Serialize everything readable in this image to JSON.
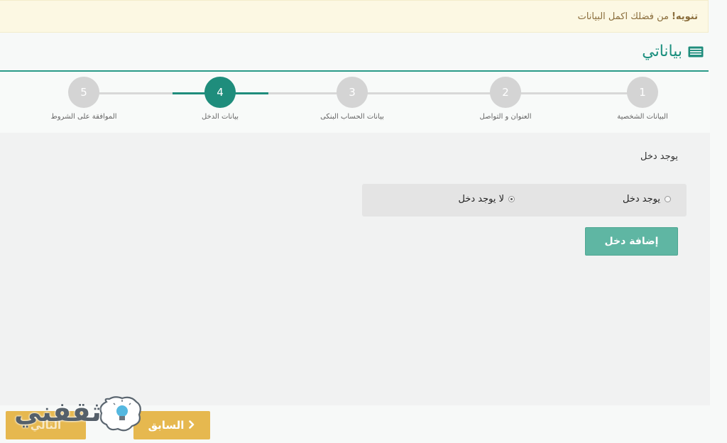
{
  "alert": {
    "strong": "تنويه!",
    "message": "من فضلك اكمل البيانات"
  },
  "section": {
    "title": "بياناتي",
    "icon": "card-icon"
  },
  "steps": [
    {
      "number": "1",
      "label": "البيانات الشخصية",
      "active": false
    },
    {
      "number": "2",
      "label": "العنوان و التواصل",
      "active": false
    },
    {
      "number": "3",
      "label": "بيانات الحساب البنكى",
      "active": false
    },
    {
      "number": "4",
      "label": "بيانات الدخل",
      "active": true
    },
    {
      "number": "5",
      "label": "الموافقة على الشروط",
      "active": false
    }
  ],
  "form": {
    "question": "يوجد دخل",
    "options": [
      {
        "label": "يوجد دخل",
        "checked": false
      },
      {
        "label": "لا يوجد دخل",
        "checked": true
      }
    ],
    "add_button": "إضافة دخل"
  },
  "footer": {
    "prev_label": "السابق",
    "next_label": "التالي"
  },
  "watermark": {
    "text": "ثقفني"
  },
  "colors": {
    "accent": "#1f8d7c",
    "button_green": "#5fb6a3",
    "button_yellow": "#e6b84f",
    "alert_bg": "#fcf8e3",
    "alert_text": "#8a6d3b"
  }
}
